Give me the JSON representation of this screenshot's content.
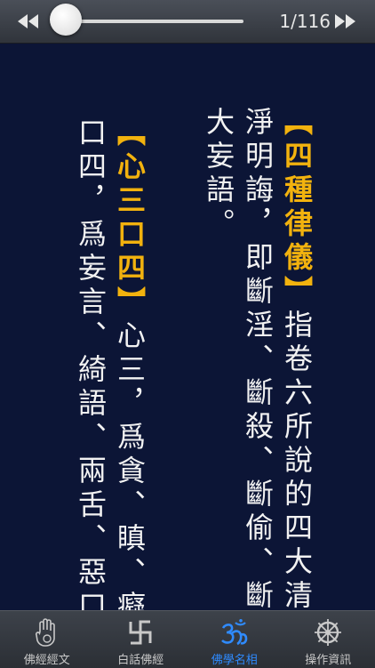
{
  "toolbar": {
    "page_counter": "1/116",
    "progress": 0.009
  },
  "content": {
    "columns": [
      {
        "term": "【四種律儀】",
        "text": "指卷六所說的四大清"
      },
      {
        "term": "",
        "text": "淨明誨，即斷淫、斷殺、斷偷、斷"
      },
      {
        "term": "",
        "text": "大妄語。"
      },
      {
        "term": "【心三口四】",
        "text": "心三，爲貪、瞋、癡；"
      },
      {
        "term": "",
        "text": "口四，爲妄言、綺語、兩舌、惡口。"
      }
    ]
  },
  "tabs": [
    {
      "label": "佛經經文",
      "icon": "hand-icon",
      "active": false
    },
    {
      "label": "白話佛經",
      "icon": "swastika-icon",
      "active": false
    },
    {
      "label": "佛學名相",
      "icon": "om-icon",
      "active": true
    },
    {
      "label": "操作資訊",
      "icon": "dharma-wheel-icon",
      "active": false
    }
  ],
  "colors": {
    "background": "#0c1536",
    "term": "#f2b20e",
    "text": "#f2f2f2",
    "active_tab": "#2f8bff",
    "inactive_tab": "#c9c9c9"
  }
}
